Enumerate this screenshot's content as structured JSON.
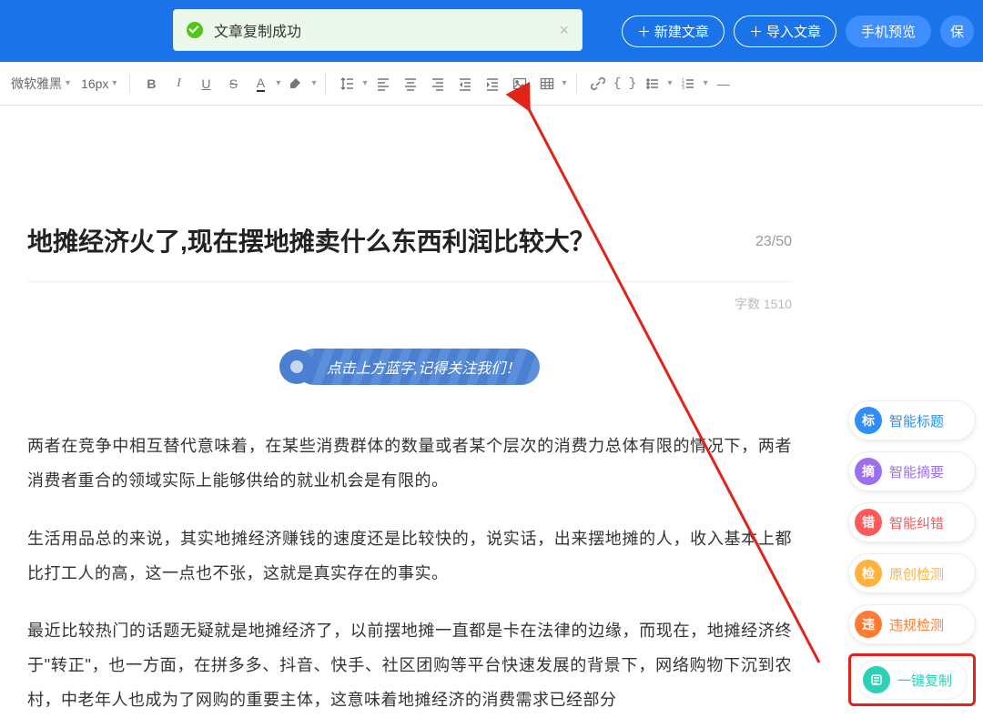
{
  "toast": {
    "message": "文章复制成功"
  },
  "topbar": {
    "new_article": "新建文章",
    "import_article": "导入文章",
    "mobile_preview": "手机预览",
    "save": "保"
  },
  "toolbar": {
    "font_family": "微软雅黑",
    "font_size": "16px"
  },
  "article": {
    "title": "地摊经济火了,现在摆地摊卖什么东西利润比较大？",
    "title_count": "23/50",
    "word_count": "字数 1510",
    "banner": "点击上方蓝字,记得关注我们！",
    "p1": "两者在竞争中相互替代意味着，在某些消费群体的数量或者某个层次的消费力总体有限的情况下，两者消费者重合的领域实际上能够供给的就业机会是有限的。",
    "p2": "生活用品总的来说，其实地摊经济赚钱的速度还是比较快的，说实话，出来摆地摊的人，收入基本上都比打工人的高，这一点也不张，这就是真实存在的事实。",
    "p3": "最近比较热门的话题无疑就是地摊经济了，以前摆地摊一直都是卡在法律的边缘，而现在，地摊经济终于\"转正\"，也一方面，在拼多多、抖音、快手、社区团购等平台快速发展的背景下，网络购物下沉到农村，中老年人也成为了网购的重要主体，这意味着地摊经济的消费需求已经部分"
  },
  "side": {
    "smart_title": {
      "icon": "标",
      "label": "智能标题",
      "icon_bg": "#2f8ef7",
      "label_color": "#2f8ef7"
    },
    "smart_summary": {
      "icon": "摘",
      "label": "智能摘要",
      "icon_bg": "#9d6ff0",
      "label_color": "#9d6ff0"
    },
    "smart_correct": {
      "icon": "错",
      "label": "智能纠错",
      "icon_bg": "#ff5a5a",
      "label_color": "#ff5a5a"
    },
    "orig_check": {
      "icon": "检",
      "label": "原创检测",
      "icon_bg": "#ffb23e",
      "label_color": "#ffb23e"
    },
    "vio_check": {
      "icon": "违",
      "label": "违规检测",
      "icon_bg": "#ff7a33",
      "label_color": "#ff7a33"
    },
    "one_copy": {
      "icon": "",
      "label": "一键复制",
      "icon_bg": "#2ed1b5",
      "label_color": "#2ed1b5"
    }
  }
}
